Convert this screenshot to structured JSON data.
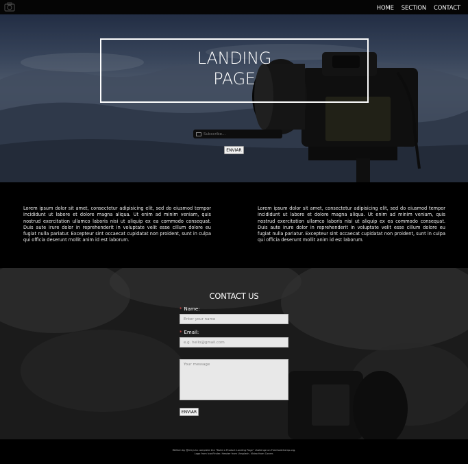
{
  "nav": {
    "logo_icon": "camera-icon",
    "links": [
      "HOME",
      "SECTION",
      "CONTACT"
    ]
  },
  "hero": {
    "title_line1": "LANDING",
    "title_line2": "PAGE",
    "subscribe_placeholder": "Subscribe...",
    "submit_label": "ENVIAR",
    "mail_icon": "mail-icon"
  },
  "content": {
    "paragraph_left": "Lorem ipsum dolor sit amet, consectetur adipisicing elit, sed do eiusmod tempor incididunt ut labore et dolore magna aliqua. Ut enim ad minim veniam, quis nostrud exercitation ullamco laboris nisi ut aliquip ex ea commodo consequat. Duis aute irure dolor in reprehenderit in voluptate velit esse cillum dolore eu fugiat nulla pariatur. Excepteur sint occaecat cupidatat non proident, sunt in culpa qui officia deserunt mollit anim id est laborum.",
    "paragraph_right": "Lorem ipsum dolor sit amet, consectetur adipisicing elit, sed do eiusmod tempor incididunt ut labore et dolore magna aliqua. Ut enim ad minim veniam, quis nostrud exercitation ullamco laboris nisi ut aliquip ex ea commodo consequat. Duis aute irure dolor in reprehenderit in voluptate velit esse cillum dolore eu fugiat nulla pariatur. Excepteur sint occaecat cupidatat non proident, sunt in culpa qui officia deserunt mollit anim id est laborum."
  },
  "contact": {
    "heading": "CONTACT US",
    "name_label": "Name:",
    "name_placeholder": "Enter your name",
    "email_label": "Email:",
    "email_placeholder": "e.g. hello@gmail.com",
    "message_placeholder": "Your message",
    "required_marker": "*",
    "submit_label": "ENVIAR"
  },
  "footer": {
    "line1": "Written by @mt.js to complete the \"Build a Product Landing Page\" challenge on FreeCodeCamp.org.",
    "line2": "Logo from IconFinder. Header from Unsplash. Video from Coverr."
  },
  "colors": {
    "nav_bg": "#050505",
    "section_bg": "#000000",
    "required": "#e55555"
  }
}
